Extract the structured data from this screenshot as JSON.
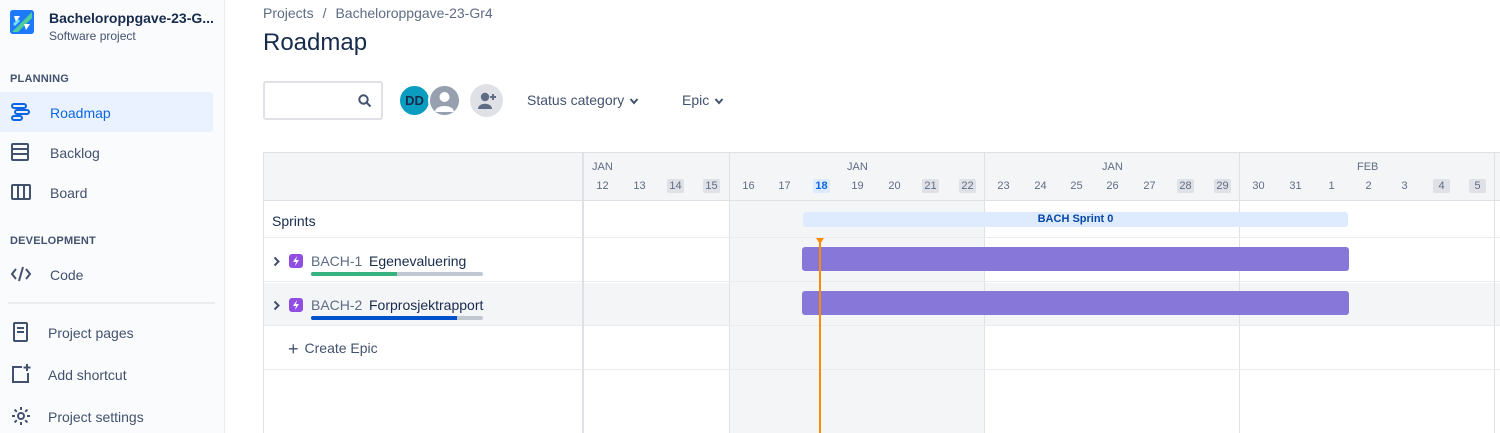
{
  "project": {
    "name": "Bacheloroppgave-23-Gr4",
    "name_display": "Bacheloroppgave-23-G...",
    "type": "Software project"
  },
  "sidebar": {
    "planning_heading": "PLANNING",
    "development_heading": "DEVELOPMENT",
    "items": [
      {
        "label": "Roadmap",
        "icon": "roadmap-icon",
        "active": true
      },
      {
        "label": "Backlog",
        "icon": "backlog-icon"
      },
      {
        "label": "Board",
        "icon": "board-icon"
      },
      {
        "label": "Code",
        "icon": "code-icon"
      },
      {
        "label": "Project pages",
        "icon": "pages-icon"
      },
      {
        "label": "Add shortcut",
        "icon": "add-shortcut-icon"
      },
      {
        "label": "Project settings",
        "icon": "gear-icon"
      }
    ]
  },
  "breadcrumb": {
    "projects": "Projects",
    "separator": "/",
    "project": "Bacheloroppgave-23-Gr4"
  },
  "page_title": "Roadmap",
  "toolbar": {
    "search_placeholder": "",
    "avatar_initials": "DD",
    "filters": [
      "Status category",
      "Epic"
    ]
  },
  "timeline": {
    "months": [
      "JAN",
      "JAN",
      "JAN",
      "FEB"
    ],
    "days": [
      "12",
      "13",
      "14",
      "15",
      "16",
      "17",
      "18",
      "19",
      "20",
      "21",
      "22",
      "23",
      "24",
      "25",
      "26",
      "27",
      "28",
      "29",
      "30",
      "31",
      "1",
      "2",
      "3",
      "4",
      "5"
    ],
    "today": "18",
    "weekend_days": [
      "14",
      "15",
      "21",
      "22",
      "28",
      "29",
      "4",
      "5"
    ]
  },
  "sprints": {
    "label": "Sprints",
    "sprint_name": "BACH Sprint 0"
  },
  "epics": [
    {
      "key": "BACH-1",
      "summary": "Egenevaluering",
      "progress_done": 0.5,
      "progress_color": "#36b37e"
    },
    {
      "key": "BACH-2",
      "summary": "Forprosjektrapport",
      "progress_done": 0.85,
      "progress_color": "#0052cc"
    }
  ],
  "create_epic_label": "Create Epic",
  "colors": {
    "accent": "#0c66e4",
    "epic_bar": "#8777d9",
    "today_marker": "#ff8b00",
    "sprint_bar": "#deebff"
  }
}
